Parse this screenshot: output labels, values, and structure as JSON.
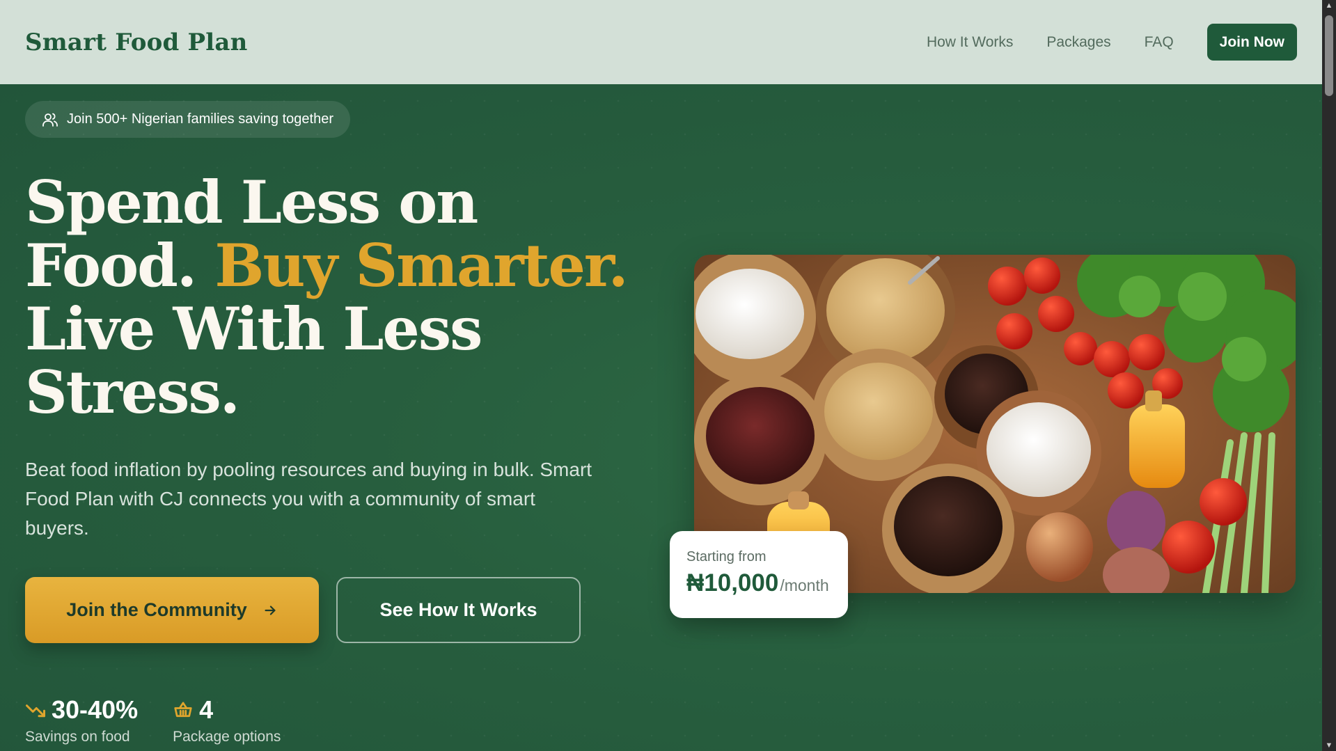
{
  "header": {
    "brand": "Smart Food Plan",
    "nav": [
      "How It Works",
      "Packages",
      "FAQ"
    ],
    "cta": "Join Now"
  },
  "hero": {
    "pill_text": "Join 500+ Nigerian families saving together",
    "headline_part1": "Spend Less on Food. ",
    "headline_accent": "Buy Smarter.",
    "headline_part2": " Live With Less Stress.",
    "subtext": "Beat food inflation by pooling resources and buying in bulk. Smart Food Plan with CJ connects you with a community of smart buyers.",
    "primary_button": "Join the Community",
    "secondary_button": "See How It Works",
    "stats": [
      {
        "value": "30-40%",
        "label": "Savings on food",
        "icon": "trending-down-icon"
      },
      {
        "value": "4",
        "label": "Package options",
        "icon": "basket-icon"
      }
    ],
    "price_card": {
      "label": "Starting from",
      "amount": "₦10,000",
      "unit": "/month"
    }
  },
  "colors": {
    "brand_green": "#1f5a3a",
    "hero_bg": "#275e3e",
    "accent_gold": "#e0a52d",
    "header_bg": "#d3e0d7"
  }
}
